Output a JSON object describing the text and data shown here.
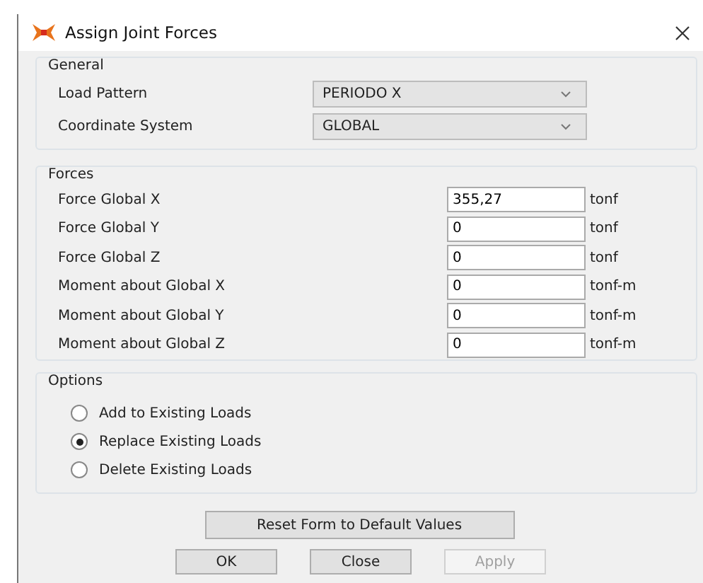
{
  "window": {
    "title": "Assign Joint Forces"
  },
  "general": {
    "title": "General",
    "fields": [
      {
        "label": "Load Pattern",
        "value": "PERIODO X"
      },
      {
        "label": "Coordinate System",
        "value": "GLOBAL"
      }
    ]
  },
  "forces": {
    "title": "Forces",
    "rows": [
      {
        "label": "Force Global X",
        "value": "355,27",
        "unit": "tonf"
      },
      {
        "label": "Force Global Y",
        "value": "0",
        "unit": "tonf"
      },
      {
        "label": "Force Global Z",
        "value": "0",
        "unit": "tonf"
      },
      {
        "label": "Moment about Global X",
        "value": "0",
        "unit": "tonf-m"
      },
      {
        "label": "Moment about Global Y",
        "value": "0",
        "unit": "tonf-m"
      },
      {
        "label": "Moment about Global Z",
        "value": "0",
        "unit": "tonf-m"
      }
    ]
  },
  "options": {
    "title": "Options",
    "items": [
      {
        "label": "Add to Existing Loads",
        "selected": false
      },
      {
        "label": "Replace Existing Loads",
        "selected": true
      },
      {
        "label": "Delete Existing Loads",
        "selected": false
      }
    ]
  },
  "reset_button": "Reset Form to Default Values",
  "buttons": [
    {
      "label": "OK",
      "disabled": false
    },
    {
      "label": "Close",
      "disabled": false
    },
    {
      "label": "Apply",
      "disabled": true
    }
  ]
}
